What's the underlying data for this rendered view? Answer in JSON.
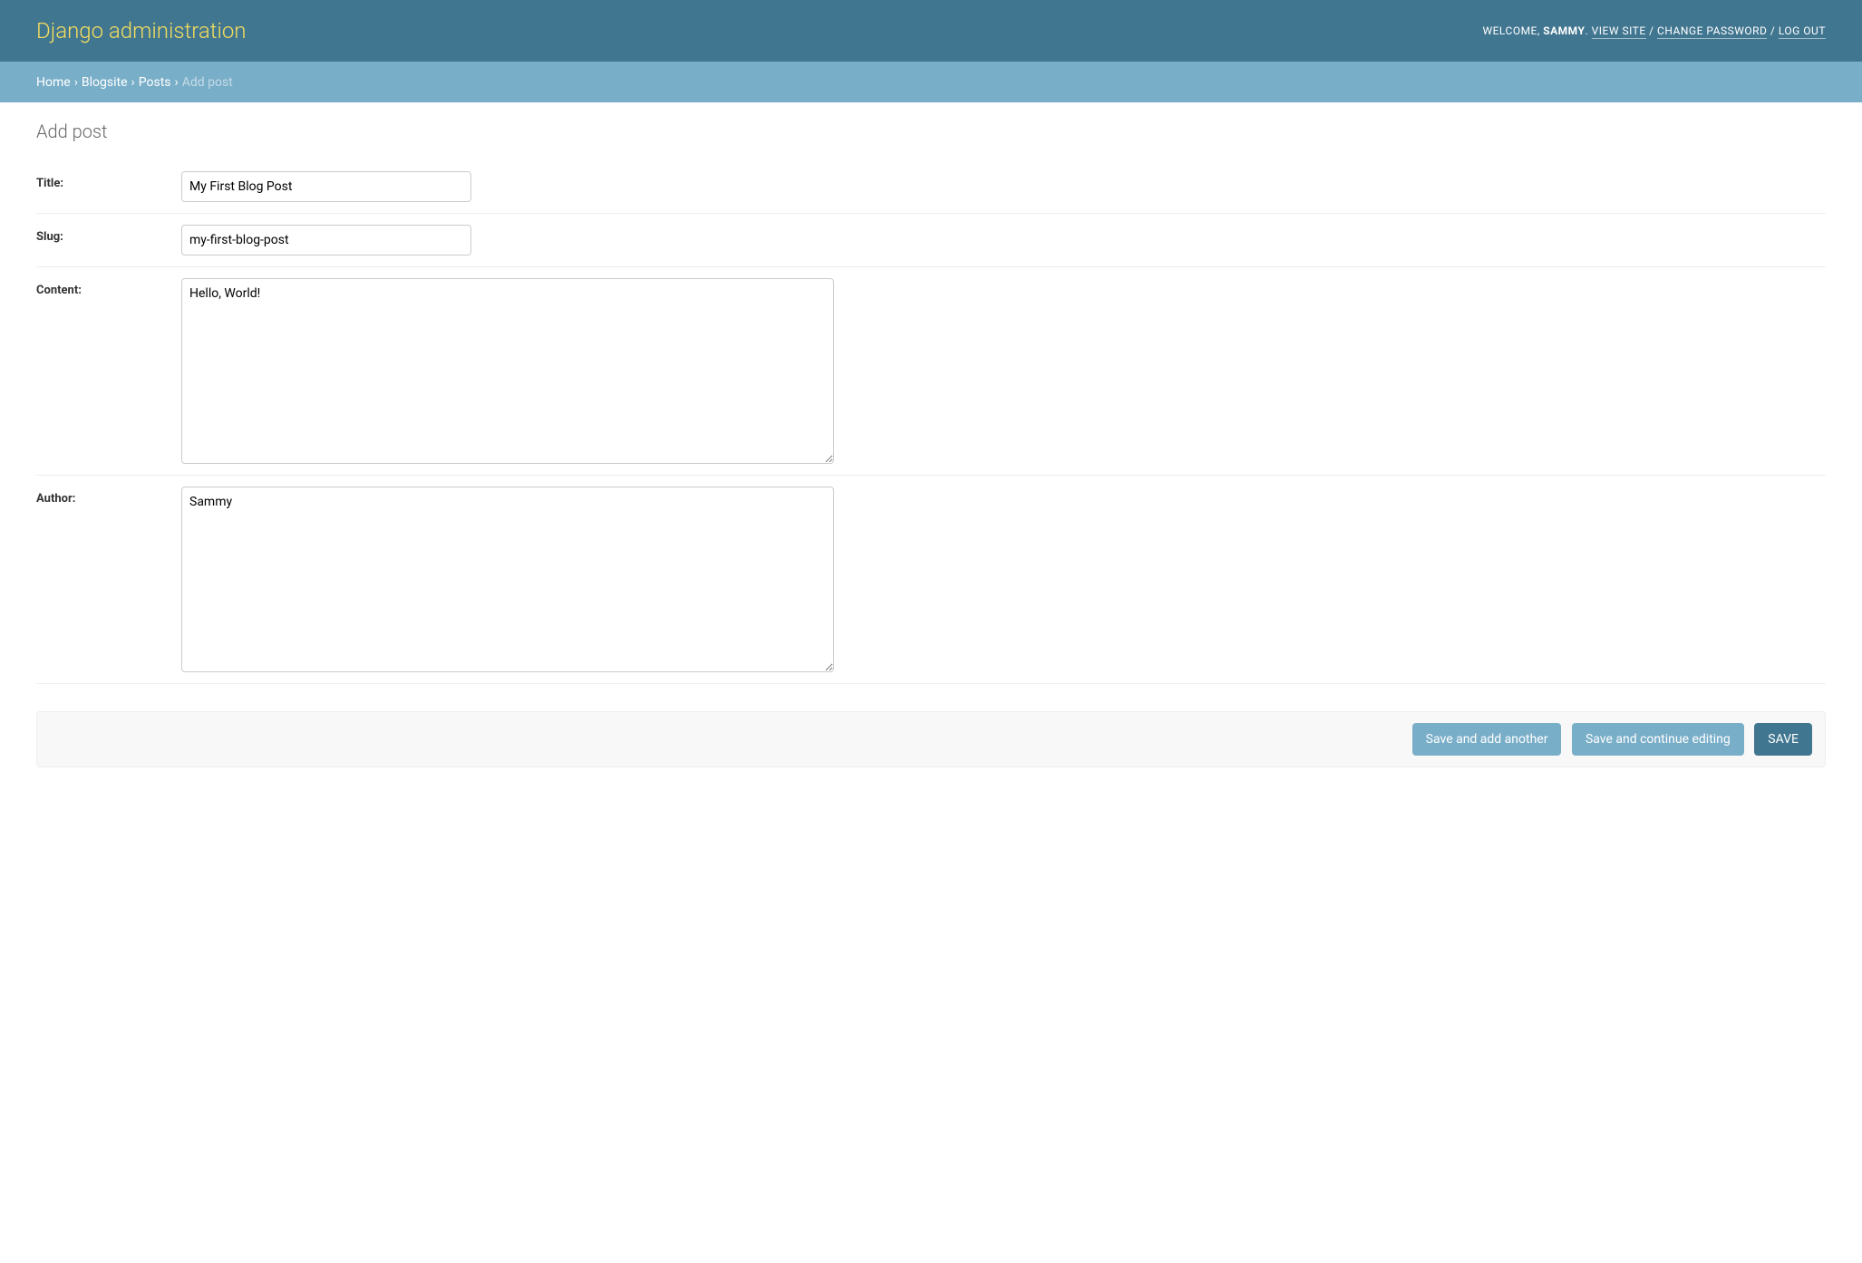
{
  "header": {
    "branding": "Django administration",
    "welcome_prefix": "WELCOME, ",
    "username": "SAMMY",
    "period": ". ",
    "view_site": "VIEW SITE",
    "change_password": "CHANGE PASSWORD",
    "logout": "LOG OUT",
    "separator": " / "
  },
  "breadcrumbs": {
    "home": "Home",
    "app": "Blogsite",
    "model": "Posts",
    "current": "Add post",
    "sep": "›"
  },
  "page_title": "Add post",
  "form": {
    "title": {
      "label": "Title:",
      "value": "My First Blog Post"
    },
    "slug": {
      "label": "Slug:",
      "value": "my-first-blog-post"
    },
    "content": {
      "label": "Content:",
      "value": "Hello, World!"
    },
    "author": {
      "label": "Author:",
      "value": "Sammy"
    }
  },
  "buttons": {
    "save_add_another": "Save and add another",
    "save_continue": "Save and continue editing",
    "save": "SAVE"
  }
}
